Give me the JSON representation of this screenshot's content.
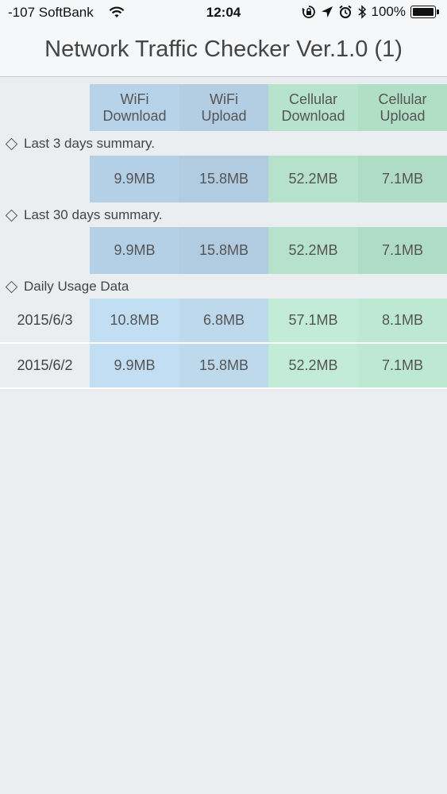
{
  "status_bar": {
    "carrier": "-107 SoftBank",
    "time": "12:04",
    "battery": "100%"
  },
  "nav": {
    "title": "Network Traffic Checker Ver.1.0 (1)"
  },
  "columns": {
    "wifi_download": "WiFi\nDownload",
    "wifi_upload": "WiFi\nUpload",
    "cellular_download": "Cellular\nDownload",
    "cellular_upload": "Cellular\nUpload"
  },
  "last3": {
    "label": "Last 3 days summary.",
    "wifi_download": "9.9MB",
    "wifi_upload": "15.8MB",
    "cellular_download": "52.2MB",
    "cellular_upload": "7.1MB"
  },
  "last30": {
    "label": "Last 30 days summary.",
    "wifi_download": "9.9MB",
    "wifi_upload": "15.8MB",
    "cellular_download": "52.2MB",
    "cellular_upload": "7.1MB"
  },
  "daily": {
    "label": "Daily Usage Data",
    "rows": [
      {
        "date": "2015/6/3",
        "wifi_download": "10.8MB",
        "wifi_upload": "6.8MB",
        "cellular_download": "57.1MB",
        "cellular_upload": "8.1MB"
      },
      {
        "date": "2015/6/2",
        "wifi_download": "9.9MB",
        "wifi_upload": "15.8MB",
        "cellular_download": "52.2MB",
        "cellular_upload": "7.1MB"
      }
    ]
  }
}
